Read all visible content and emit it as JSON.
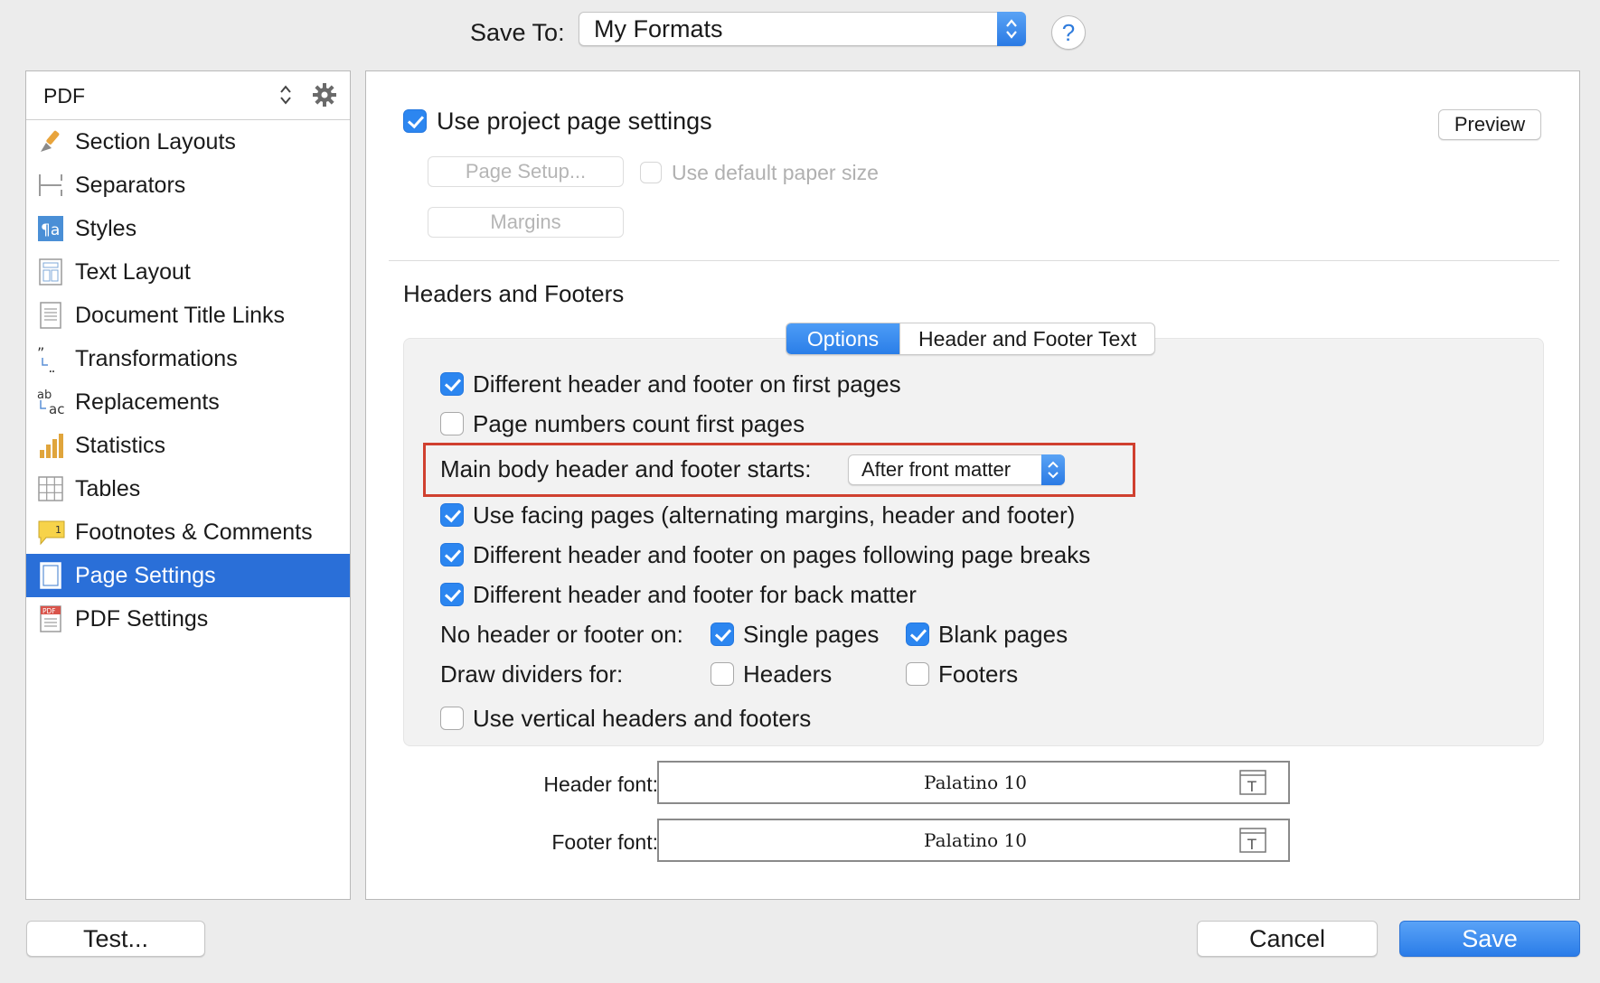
{
  "save_to": {
    "label": "Save To:",
    "value": "My Formats",
    "help": "?"
  },
  "sidebar": {
    "format": "PDF",
    "items": [
      {
        "label": "Section Layouts",
        "icon": "brush-icon"
      },
      {
        "label": "Separators",
        "icon": "separators-icon"
      },
      {
        "label": "Styles",
        "icon": "styles-icon"
      },
      {
        "label": "Text Layout",
        "icon": "text-layout-icon"
      },
      {
        "label": "Document Title Links",
        "icon": "document-icon"
      },
      {
        "label": "Transformations",
        "icon": "quotes-icon"
      },
      {
        "label": "Replacements",
        "icon": "replacements-icon"
      },
      {
        "label": "Statistics",
        "icon": "bar-chart-icon"
      },
      {
        "label": "Tables",
        "icon": "table-icon"
      },
      {
        "label": "Footnotes & Comments",
        "icon": "footnote-icon"
      },
      {
        "label": "Page Settings",
        "icon": "page-icon",
        "selected": true
      },
      {
        "label": "PDF Settings",
        "icon": "pdf-icon"
      }
    ],
    "selected_color": "#2a6fd8"
  },
  "main": {
    "use_project_page_settings": {
      "label": "Use project page settings",
      "checked": true
    },
    "preview_button": "Preview",
    "page_setup_button": "Page Setup...",
    "use_default_paper_size": {
      "label": "Use default paper size",
      "checked": false
    },
    "margins_button": "Margins",
    "headers_footers_title": "Headers and Footers",
    "tabs": [
      {
        "label": "Options",
        "active": true
      },
      {
        "label": "Header and Footer Text",
        "active": false
      }
    ],
    "options": {
      "diff_first_pages": {
        "label": "Different header and footer on first pages",
        "checked": true
      },
      "page_numbers_count_first": {
        "label": "Page numbers count first pages",
        "checked": false
      },
      "main_body_starts": {
        "label": "Main body header and footer starts:",
        "value": "After front matter"
      },
      "facing_pages": {
        "label": "Use facing pages (alternating margins, header and footer)",
        "checked": true
      },
      "diff_following_breaks": {
        "label": "Different header and footer on pages following page breaks",
        "checked": true
      },
      "diff_back_matter": {
        "label": "Different header and footer for back matter",
        "checked": true
      },
      "no_header_footer_on": {
        "label": "No header or footer on:",
        "single_pages": {
          "label": "Single pages",
          "checked": true
        },
        "blank_pages": {
          "label": "Blank pages",
          "checked": true
        }
      },
      "draw_dividers_for": {
        "label": "Draw dividers for:",
        "headers": {
          "label": "Headers",
          "checked": false
        },
        "footers": {
          "label": "Footers",
          "checked": false
        }
      },
      "vertical_headers": {
        "label": "Use vertical headers and footers",
        "checked": false
      }
    },
    "header_font": {
      "label": "Header font:",
      "value": "Palatino 10"
    },
    "footer_font": {
      "label": "Footer font:",
      "value": "Palatino 10"
    }
  },
  "footer": {
    "test_button": "Test...",
    "cancel_button": "Cancel",
    "save_button": "Save"
  },
  "colors": {
    "accent": "#2c86f0",
    "highlight_border": "#d0402f"
  }
}
